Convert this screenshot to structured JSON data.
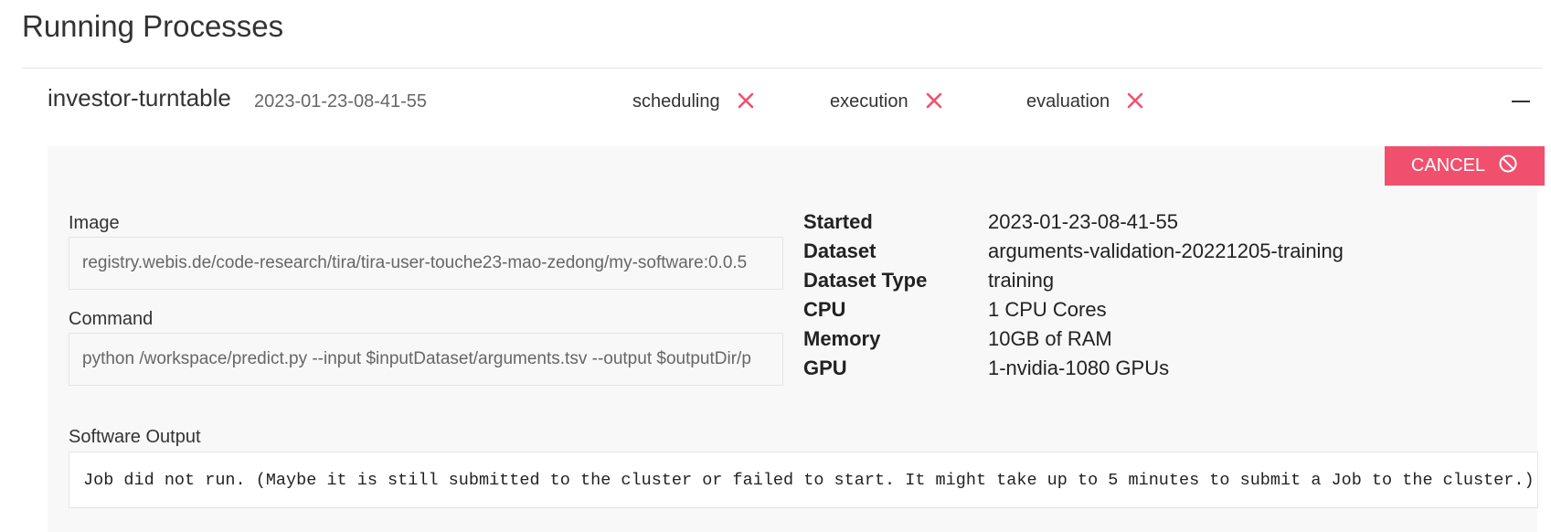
{
  "page": {
    "title": "Running Processes"
  },
  "process": {
    "name": "investor-turntable",
    "timestamp": "2023-01-23-08-41-55",
    "stages": [
      {
        "label": "scheduling",
        "status_icon": "x-icon"
      },
      {
        "label": "execution",
        "status_icon": "x-icon"
      },
      {
        "label": "evaluation",
        "status_icon": "x-icon"
      }
    ],
    "collapse_icon": "minus-icon"
  },
  "actions": {
    "cancel_label": "CANCEL",
    "cancel_icon": "ban-icon"
  },
  "fields": {
    "image_label": "Image",
    "image_value": "registry.webis.de/code-research/tira/tira-user-touche23-mao-zedong/my-software:0.0.5",
    "command_label": "Command",
    "command_value": "python /workspace/predict.py --input $inputDataset/arguments.tsv --output $outputDir/p"
  },
  "details": [
    {
      "key": "Started",
      "value": "2023-01-23-08-41-55"
    },
    {
      "key": "Dataset",
      "value": "arguments-validation-20221205-training"
    },
    {
      "key": "Dataset Type",
      "value": "training"
    },
    {
      "key": "CPU",
      "value": "1 CPU Cores"
    },
    {
      "key": "Memory",
      "value": "10GB of RAM"
    },
    {
      "key": "GPU",
      "value": "1-nvidia-1080 GPUs"
    }
  ],
  "output": {
    "label": "Software Output",
    "text": "Job did not run. (Maybe it is still submitted to the cluster or failed to start. It might take up to 5 minutes to submit a Job to the cluster.)"
  },
  "colors": {
    "accent": "#f0506e",
    "panel_bg": "#f8f8f8",
    "text": "#333333"
  }
}
